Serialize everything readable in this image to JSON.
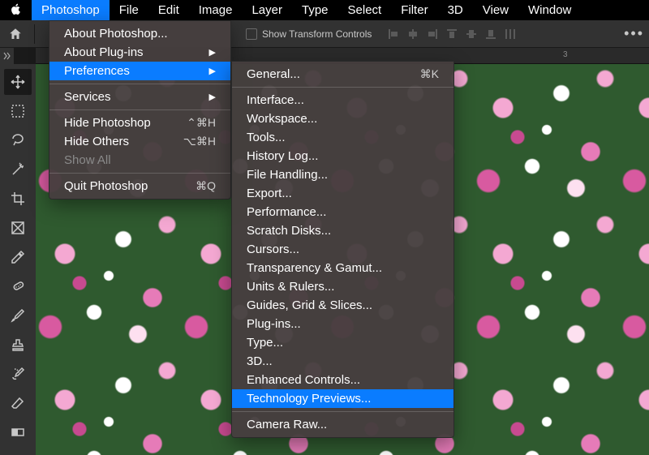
{
  "menubar": {
    "items": [
      "Photoshop",
      "File",
      "Edit",
      "Image",
      "Layer",
      "Type",
      "Select",
      "Filter",
      "3D",
      "View",
      "Window"
    ],
    "active_index": 0
  },
  "optionsbar": {
    "transform_label": "Show Transform Controls"
  },
  "ruler": {
    "mark3": "3"
  },
  "app_menu": {
    "about": "About Photoshop...",
    "about_plugins": "About Plug-ins",
    "preferences": "Preferences",
    "services": "Services",
    "hide_ps": "Hide Photoshop",
    "hide_ps_sc": "⌃⌘H",
    "hide_others": "Hide Others",
    "hide_others_sc": "⌥⌘H",
    "show_all": "Show All",
    "quit": "Quit Photoshop",
    "quit_sc": "⌘Q"
  },
  "prefs_menu": {
    "general": "General...",
    "general_sc": "⌘K",
    "items": [
      "Interface...",
      "Workspace...",
      "Tools...",
      "History Log...",
      "File Handling...",
      "Export...",
      "Performance...",
      "Scratch Disks...",
      "Cursors...",
      "Transparency & Gamut...",
      "Units & Rulers...",
      "Guides, Grid & Slices...",
      "Plug-ins...",
      "Type...",
      "3D...",
      "Enhanced Controls...",
      "Technology Previews..."
    ],
    "highlight": "Technology Previews...",
    "camera_raw": "Camera Raw..."
  },
  "tools": [
    "move-tool",
    "rectangular-marquee-tool",
    "lasso-tool",
    "magic-wand-tool",
    "crop-tool",
    "frame-tool",
    "eyedropper-tool",
    "spot-healing-tool",
    "brush-tool",
    "clone-stamp-tool",
    "history-brush-tool",
    "eraser-tool",
    "gradient-tool"
  ]
}
